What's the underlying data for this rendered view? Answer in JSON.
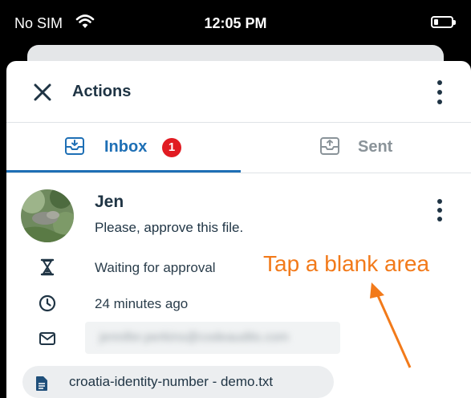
{
  "status_bar": {
    "carrier": "No SIM",
    "time": "12:05 PM",
    "wifi_icon": "wifi-icon",
    "battery_icon": "battery-icon"
  },
  "header": {
    "title": "Actions",
    "close_icon": "close-icon",
    "more_icon": "more-vertical-icon"
  },
  "tabs": [
    {
      "label": "Inbox",
      "icon": "inbox-icon",
      "badge": "1",
      "active": true
    },
    {
      "label": "Sent",
      "icon": "outbox-icon",
      "active": false
    }
  ],
  "item": {
    "sender": "Jen",
    "message": "Please, approve this file.",
    "status": "Waiting for approval",
    "time_ago": "24 minutes ago",
    "email": "jennifer.perkins@codeaudits.com",
    "file_name": "croatia-identity-number - demo.txt"
  },
  "annotation": {
    "text": "Tap a blank area"
  },
  "colors": {
    "accent": "#1e6fb5",
    "badge": "#e11b22",
    "annotation": "#f27a1a",
    "text": "#1f3444"
  }
}
